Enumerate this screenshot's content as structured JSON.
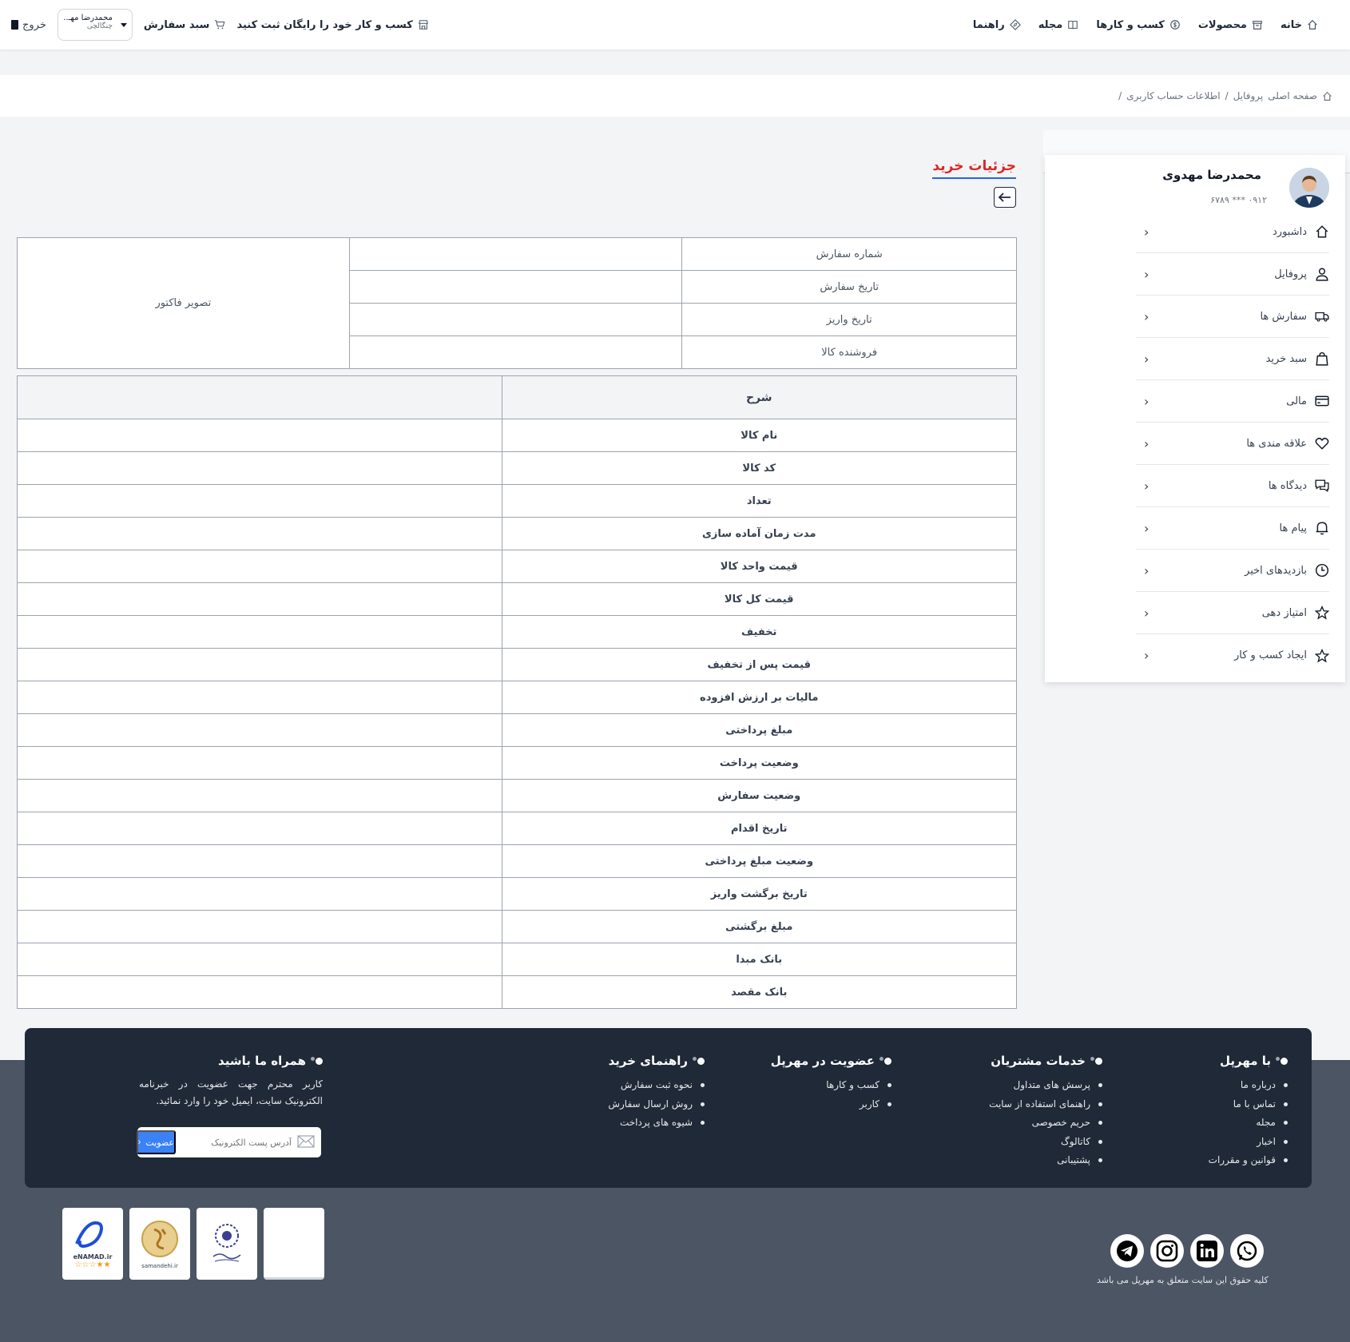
{
  "nav": {
    "items": [
      {
        "label": "خانه",
        "icon": "home-icon"
      },
      {
        "label": "محصولات",
        "icon": "archive-icon"
      },
      {
        "label": "کسب و کارها",
        "icon": "dollar-icon"
      },
      {
        "label": "مجله",
        "icon": "book-icon"
      },
      {
        "label": "راهنما",
        "icon": "compass-icon"
      }
    ],
    "register_business": "کسب و کار خود را رایگان ثبت کنید",
    "cart": "سبد سفارش",
    "user_name": "محمدرضا مهـ...",
    "user_role": "چنگالچی",
    "logout": "خروج"
  },
  "breadcrumb": {
    "home": "صفحه اصلی",
    "profile": "پروفایل",
    "separator": "/",
    "current": "اطلاعات حساب کاربری"
  },
  "sidebar": {
    "name": "محمدرضا مهدوی",
    "phone": "۰۹۱۲ *** ۶۷۸۹",
    "items": [
      {
        "label": "داشبورد",
        "icon": "home-icon"
      },
      {
        "label": "پروفایل",
        "icon": "user-icon"
      },
      {
        "label": "سفارش ها",
        "icon": "truck-icon"
      },
      {
        "label": "سبد خرید",
        "icon": "shopping-bag-icon"
      },
      {
        "label": "مالی",
        "icon": "credit-card-icon"
      },
      {
        "label": "علاقه مندی ها",
        "icon": "heart-icon"
      },
      {
        "label": "دیدگاه ها",
        "icon": "comments-icon"
      },
      {
        "label": "پیام ها",
        "icon": "bell-icon"
      },
      {
        "label": "بازدیدهای اخیر",
        "icon": "clock-icon"
      },
      {
        "label": "امتیاز دهی",
        "icon": "star-icon"
      },
      {
        "label": "ایجاد کسب و کار",
        "icon": "star-icon"
      }
    ]
  },
  "main": {
    "title": "جزئیات خرید",
    "info_rows": [
      {
        "label": "شماره سفارش",
        "value": ""
      },
      {
        "label": "تاریخ سفارش",
        "value": ""
      },
      {
        "label": "تاریخ واریز",
        "value": ""
      },
      {
        "label": "فروشنده کالا",
        "value": ""
      }
    ],
    "invoice_image_label": "تصویر فاکتور",
    "detail_header": "شرح",
    "detail_rows": [
      "نام کالا",
      "کد کالا",
      "تعداد",
      "مدت زمان آماده سازی",
      "قیمت واحد کالا",
      "قیمت کل کالا",
      "تخفیف",
      "قیمت پس از تخفیف",
      "مالیات بر ارزش افزوده",
      "مبلغ پرداختی",
      "وضعیت پرداخت",
      "وضعیت سفارش",
      "تاریخ اقدام",
      "وضعیت مبلغ پرداختی",
      "تاریخ برگشت واریز",
      "مبلغ برگشتی",
      "بانک مبدا",
      "بانک مقصد"
    ]
  },
  "footer": {
    "about": {
      "title": "با مهرپل",
      "links": [
        "درباره ما",
        "تماس با ما",
        "مجله",
        "اخبار",
        "قوانین و مقررات"
      ]
    },
    "services": {
      "title": "خدمات مشتریان",
      "links": [
        "پرسش های متداول",
        "راهنمای استفاده از سایت",
        "حریم خصوصی",
        "کاتالوگ",
        "پشتیبانی"
      ]
    },
    "membership": {
      "title": "عضویت در مهرپل",
      "links": [
        "کسب و کارها",
        "کاربر"
      ]
    },
    "guide": {
      "title": "راهنمای خرید",
      "links": [
        "نحوه ثبت سفارش",
        "روش ارسال سفارش",
        "شیوه های پرداخت"
      ]
    },
    "newsletter": {
      "title": "همراه ما باشید",
      "text": "کاربر محترم جهت عضویت در خبرنامه الکترونیک سایت، ایمیل خود را وارد نمائید.",
      "placeholder": "آدرس پست الکترونیک",
      "button": "عضویت"
    },
    "badges": [
      "eNAMAD.ir",
      "samandehi.ir"
    ],
    "socials": [
      "telegram-icon",
      "instagram-icon",
      "linkedin-icon",
      "whatsapp-icon"
    ],
    "copyright": "کلیه حقوق این سایت متعلق به مهرپل می باشد"
  }
}
